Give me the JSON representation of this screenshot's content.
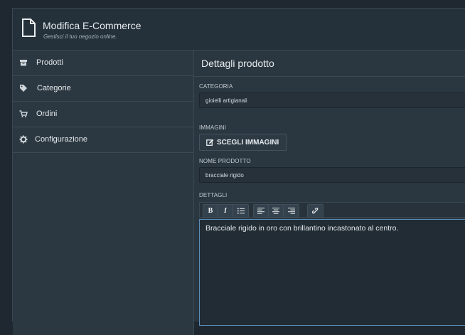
{
  "header": {
    "title": "Modifica E-Commerce",
    "subtitle": "Gestisci il tuo negozio online."
  },
  "sidebar": {
    "items": [
      {
        "label": "Prodotti",
        "icon": "archive-icon"
      },
      {
        "label": "Categorie",
        "icon": "tags-icon"
      },
      {
        "label": "Ordini",
        "icon": "cart-icon"
      },
      {
        "label": "Configurazione",
        "icon": "gear-icon"
      }
    ]
  },
  "main": {
    "title": "Dettagli prodotto",
    "category": {
      "label": "CATEGORIA",
      "value": "gioielli artigianali"
    },
    "images": {
      "label": "IMMAGINI",
      "button_label": "SCEGLI IMMAGINI"
    },
    "name": {
      "label": "NOME PRODOTTO",
      "value": "bracciale rigido"
    },
    "details": {
      "label": "DETTAGLI",
      "toolbar": [
        "B",
        "I"
      ],
      "text": "Bracciale rigido in oro con brillantino incastonato al centro."
    }
  },
  "colors": {
    "background": "#1f2830",
    "panel": "#2b3740",
    "accent_border": "#5b8fb9"
  }
}
